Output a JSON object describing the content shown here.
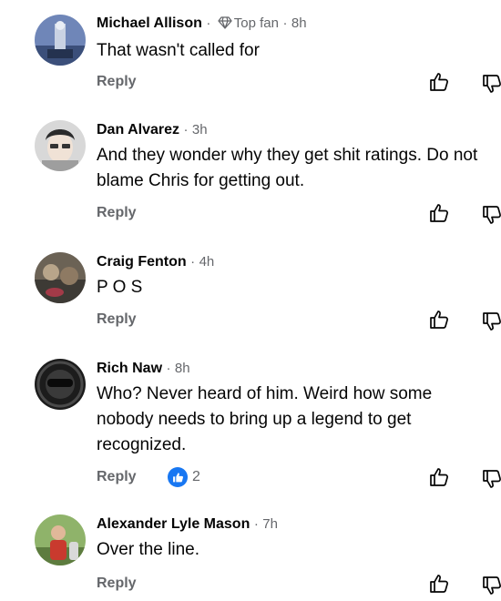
{
  "icons": {
    "top_fan": "diamond-badge-icon",
    "like": "thumbs-up-outline-icon",
    "dislike": "thumbs-down-outline-icon",
    "reaction": "like-reaction-icon"
  },
  "colors": {
    "accent": "#1877f2",
    "secondary_text": "#65676b"
  },
  "comments": [
    {
      "name": "Michael Allison",
      "sep1": "·",
      "badge": "Top fan",
      "sep2": "·",
      "time": "8h",
      "text": "That wasn't called for",
      "reply": "Reply"
    },
    {
      "name": "Dan Alvarez",
      "sep1": "·",
      "time": "3h",
      "text": "And they wonder why they get shit ratings. Do not blame Chris for getting out.",
      "reply": "Reply"
    },
    {
      "name": "Craig Fenton",
      "sep1": "·",
      "time": "4h",
      "text": "P O S",
      "reply": "Reply"
    },
    {
      "name": "Rich Naw",
      "sep1": "·",
      "time": "8h",
      "text": "Who? Never heard of him. Weird how some nobody needs to bring up a legend to get recognized.",
      "reply": "Reply",
      "like_count": "2"
    },
    {
      "name": "Alexander Lyle Mason",
      "sep1": "·",
      "time": "7h",
      "text": "Over the line.",
      "reply": "Reply"
    }
  ]
}
